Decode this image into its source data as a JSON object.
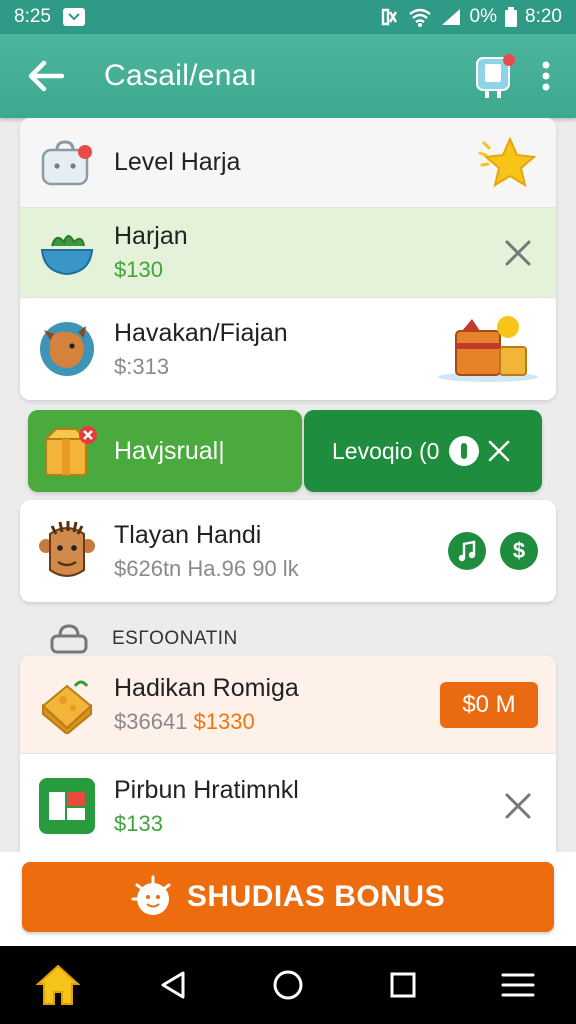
{
  "status_bar": {
    "time_left": "8:25",
    "right_pct": "0%",
    "time_right": "8:20"
  },
  "app_bar": {
    "title": "Casail/enaı"
  },
  "card1": {
    "level": {
      "title": "Level Harja"
    },
    "item1": {
      "title": "Harjan",
      "price": "$130"
    },
    "item2": {
      "title": "Havakan/Fiajan",
      "price": "$:313"
    }
  },
  "split_button": {
    "left_label": "Havjsrual|",
    "right_label": "Levoqio (0"
  },
  "card2": {
    "title": "Tlayan Handi",
    "subtitle": "$626tn Ha.96 90 lk"
  },
  "section": {
    "label": "ESГOONATIN"
  },
  "card3": {
    "item1": {
      "title": "Hadikan Romiga",
      "price_old": "$36641",
      "price_new": "$1330",
      "button": "$0 M"
    },
    "item2": {
      "title": "Pirbun Hratimnkl",
      "price": "$133"
    }
  },
  "bonus": {
    "label": "SHUDIAS BONUS"
  },
  "colors": {
    "teal": "#3ea88f",
    "green": "#43a33a",
    "dark_green": "#1f8d3e",
    "orange": "#ec6c0e"
  }
}
